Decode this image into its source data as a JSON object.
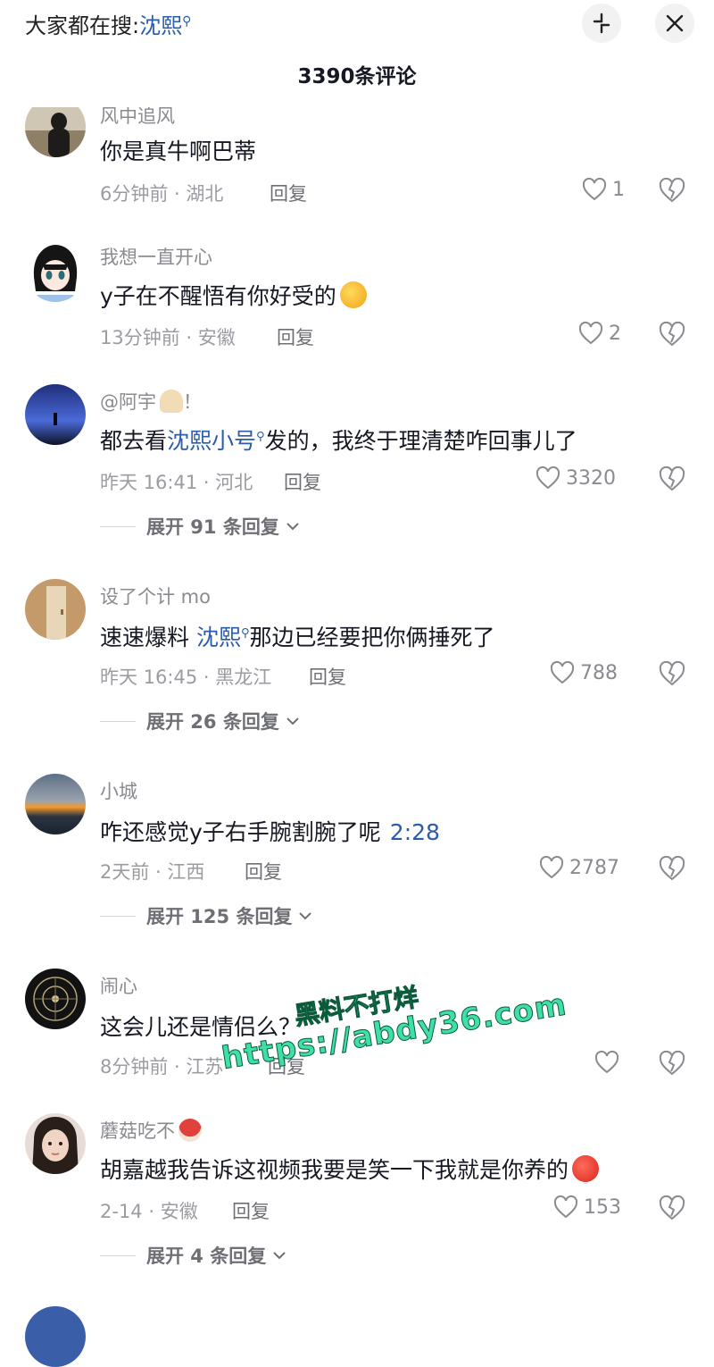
{
  "header": {
    "search_prefix": "大家都在搜:",
    "search_keyword": "沈熙",
    "comment_count": "3390条评论"
  },
  "comments": [
    {
      "username": "风中追风",
      "text": "你是真牛啊巴蒂",
      "time": "6分钟前",
      "location": "湖北",
      "reply_label": "回复",
      "likes": "1"
    },
    {
      "username": "我想一直开心",
      "text": "y子在不醒悟有你好受的",
      "time": "13分钟前",
      "location": "安徽",
      "reply_label": "回复",
      "likes": "2"
    },
    {
      "username": "@阿宇",
      "username_suffix": "！",
      "text_before": "都去看",
      "text_link": "沈熙小号",
      "text_after": "发的，我终于理清楚咋回事儿了",
      "time": "昨天 16:41",
      "location": "河北",
      "reply_label": "回复",
      "likes": "3320",
      "expand_label": "展开 91 条回复"
    },
    {
      "username": "设了个计 mo",
      "text_before": "速速爆料 ",
      "text_link": "沈熙",
      "text_after": "那边已经要把你俩捶死了",
      "time": "昨天 16:45",
      "location": "黑龙江",
      "reply_label": "回复",
      "likes": "788",
      "expand_label": "展开 26 条回复"
    },
    {
      "username": "小城",
      "text": "咋还感觉y子右手腕割腕了呢",
      "text_timestamp": "2:28",
      "time": "2天前",
      "location": "江西",
      "reply_label": "回复",
      "likes": "2787",
      "expand_label": "展开 125 条回复"
    },
    {
      "username": "闹心",
      "text": "这会儿还是情侣么？",
      "time": "8分钟前",
      "location": "江苏",
      "reply_label": "回复",
      "likes": ""
    },
    {
      "username": "蘑菇吃不",
      "text": "胡嘉越我告诉这视频我要是笑一下我就是你养的",
      "time": "2-14",
      "location": "安徽",
      "reply_label": "回复",
      "likes": "153",
      "expand_label": "展开 4 条回复"
    }
  ],
  "watermark": {
    "line1": "黑料不打烊",
    "line2": "https://abdy36.com"
  },
  "colors": {
    "link_blue": "#2a5caa",
    "meta_gray": "#9b9ca2",
    "watermark_green": "#3fe0a8"
  },
  "icons": [
    "collapse-icon",
    "close-icon",
    "search-glass-icon",
    "heart-icon",
    "dislike-heart-icon",
    "chevron-down-icon"
  ]
}
